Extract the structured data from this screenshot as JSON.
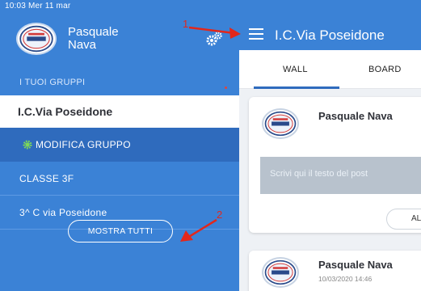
{
  "status_bar": {
    "time_date": "10:03  Mer 11 mar"
  },
  "profile": {
    "name": "Pasquale Nava"
  },
  "sidebar": {
    "section_title": "I TUOI GRUPPI",
    "active_group": "I.C.Via Poseidone",
    "edit_group_label": "MODIFICA GRUPPO",
    "groups": [
      {
        "label": "CLASSE 3F"
      },
      {
        "label": "3^ C via Poseidone"
      }
    ],
    "show_all_label": "MOSTRA TUTTI"
  },
  "header": {
    "title": "I.C.Via Poseidone"
  },
  "tabs": [
    {
      "label": "WALL",
      "active": true
    },
    {
      "label": "BOARD",
      "active": false
    }
  ],
  "feed": {
    "composer": {
      "author": "Pasquale Nava",
      "placeholder": "Scrivi qui il testo del post",
      "audience_button": "ALL"
    },
    "posts": [
      {
        "author": "Pasquale Nava",
        "date": "10/03/2020 14:46"
      }
    ]
  },
  "annotations": [
    {
      "number": "1"
    },
    {
      "number": "2"
    }
  ],
  "colors": {
    "primary": "#3b82d6",
    "primary_dark": "#2f6bbd",
    "accent_green": "#7ed957",
    "annotation_red": "#e2271b"
  }
}
